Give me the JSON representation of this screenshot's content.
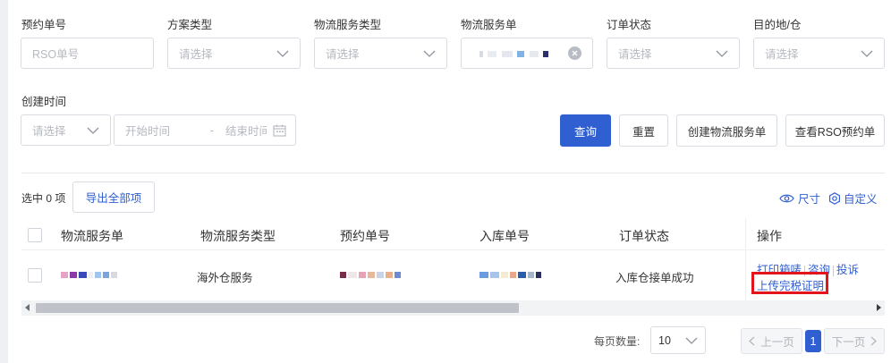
{
  "filters": {
    "rso_number": {
      "label": "预约单号",
      "placeholder": "RSO单号"
    },
    "plan_type": {
      "label": "方案类型",
      "placeholder": "请选择"
    },
    "logistics_service_type": {
      "label": "物流服务类型",
      "placeholder": "请选择"
    },
    "logistics_service_order": {
      "label": "物流服务单"
    },
    "order_status": {
      "label": "订单状态",
      "placeholder": "请选择"
    },
    "destination": {
      "label": "目的地/仓",
      "placeholder": "请选择"
    },
    "created_time": {
      "label": "创建时间",
      "select_placeholder": "请选择",
      "start_placeholder": "开始时间",
      "range_separator": "-",
      "end_placeholder": "结束时间"
    }
  },
  "actions": {
    "query": "查询",
    "reset": "重置",
    "create_logistics_order": "创建物流服务单",
    "view_rso": "查看RSO预约单"
  },
  "toolbar": {
    "selected_count": "选中 0 项",
    "export_all": "导出全部项",
    "size": "尺寸",
    "customize_columns": "自定义列"
  },
  "table": {
    "headers": {
      "logistics_order": "物流服务单",
      "logistics_type": "物流服务类型",
      "rso_number": "预约单号",
      "inbound_number": "入库单号",
      "order_status": "订单状态",
      "operations": "操作"
    },
    "rows": [
      {
        "logistics_type": "海外仓服务",
        "order_status": "入库仓接单成功",
        "ops": {
          "print_labels": "打印箱唛",
          "consult": "咨询",
          "complain": "投诉",
          "upload_tax_proof": "上传完税证明"
        }
      }
    ]
  },
  "pagination": {
    "page_size_label": "每页数量:",
    "page_size": "10",
    "prev": "上一页",
    "current_page": "1",
    "next": "下一页"
  },
  "colors": {
    "primary": "#2f5fd0",
    "highlight": "#e3141b",
    "border": "#d9dce2"
  },
  "icons": [
    "chevron-down-icon",
    "clear-icon",
    "calendar-icon",
    "eye-icon",
    "gear-icon",
    "chevron-left-icon",
    "chevron-right-icon"
  ]
}
